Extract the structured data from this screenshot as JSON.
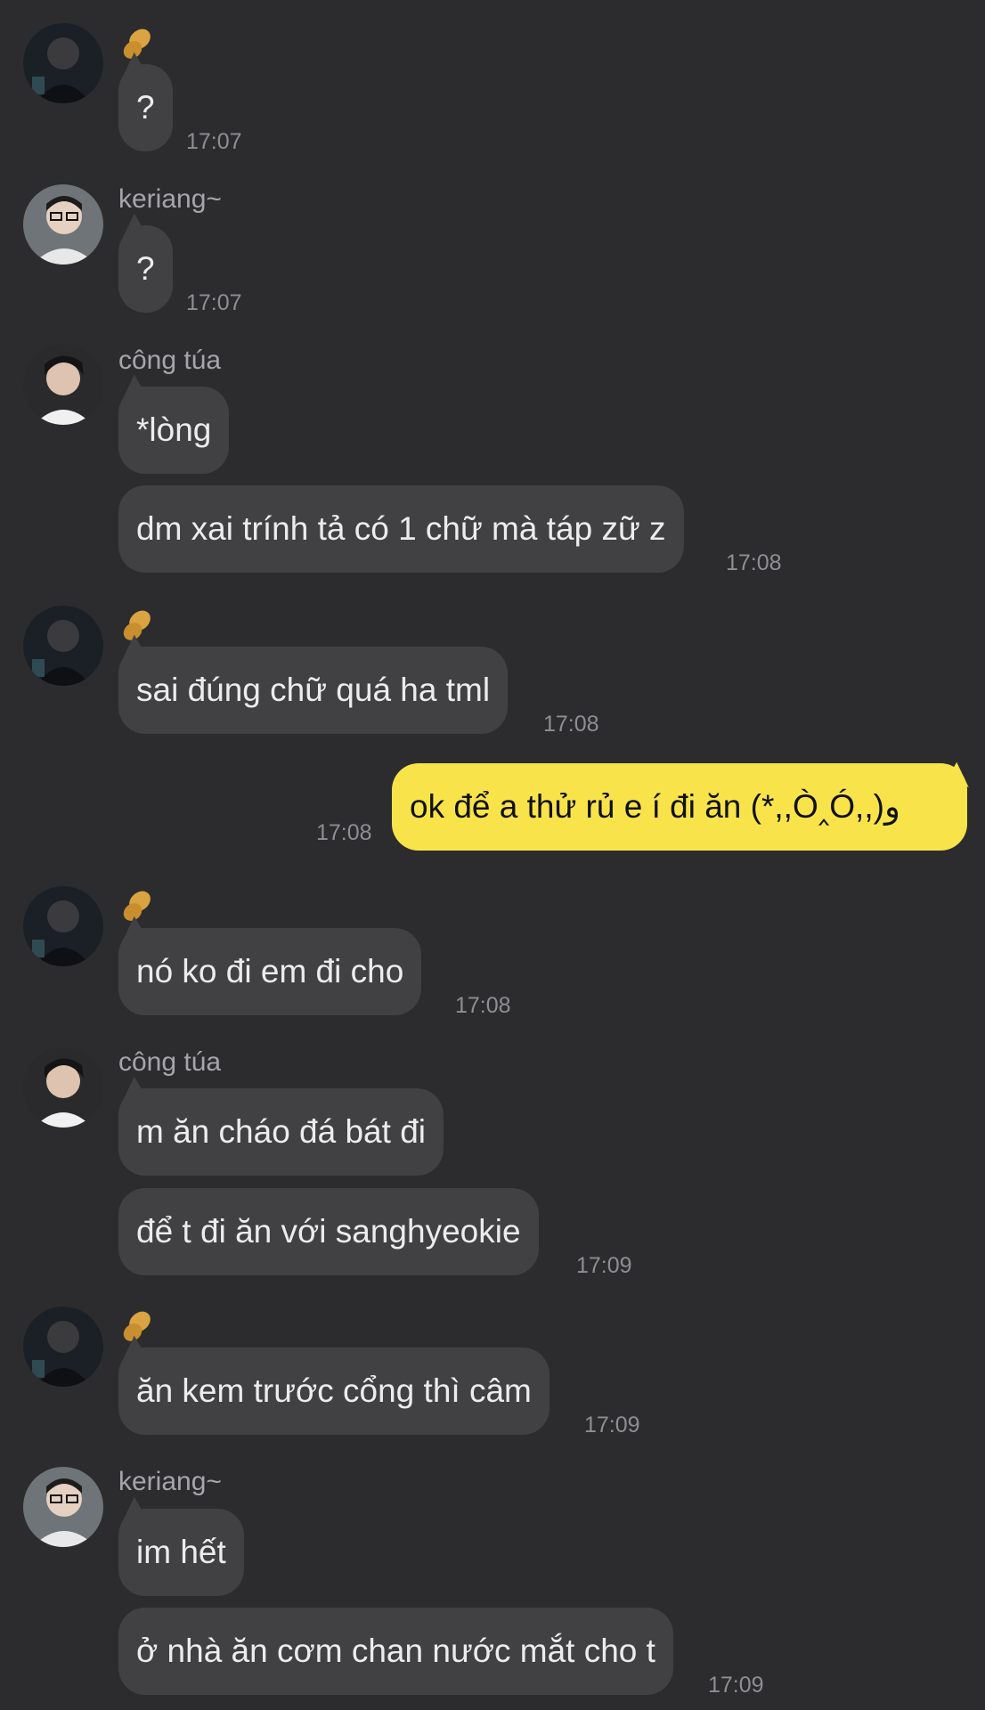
{
  "colors": {
    "background": "#2c2c2e",
    "bubble_other": "#414143",
    "bubble_mine": "#f8e44a",
    "timestamp": "#8e8e93"
  },
  "messages": [
    {
      "sender": "",
      "icon": "peanut-icon",
      "text": "?",
      "time": "17:07"
    },
    {
      "sender": "keriang~",
      "text": "?",
      "time": "17:07"
    },
    {
      "sender": "công túa",
      "text": "*lòng",
      "time": ""
    },
    {
      "sender": "công túa",
      "text": "dm xai trính tả có 1 chữ mà táp zữ z",
      "time": "17:08"
    },
    {
      "sender": "",
      "icon": "peanut-icon",
      "text": "sai đúng chữ quá ha tml",
      "time": "17:08"
    },
    {
      "sender": "me",
      "text": "ok để a thử rủ e í đi ăn (*,,Ò‸Ó,,)و",
      "time": "17:08"
    },
    {
      "sender": "",
      "icon": "peanut-icon",
      "text": "nó ko đi em đi cho",
      "time": "17:08"
    },
    {
      "sender": "công túa",
      "text": "m ăn cháo đá bát đi",
      "time": ""
    },
    {
      "sender": "công túa",
      "text": "để t đi ăn với sanghyeokie",
      "time": "17:09"
    },
    {
      "sender": "",
      "icon": "peanut-icon",
      "text": "ăn kem trước cổng thì câm",
      "time": "17:09"
    },
    {
      "sender": "keriang~",
      "text": "im hết",
      "time": ""
    },
    {
      "sender": "keriang~",
      "text": "ở nhà ăn cơm chan nước mắt cho t",
      "time": "17:09"
    }
  ]
}
